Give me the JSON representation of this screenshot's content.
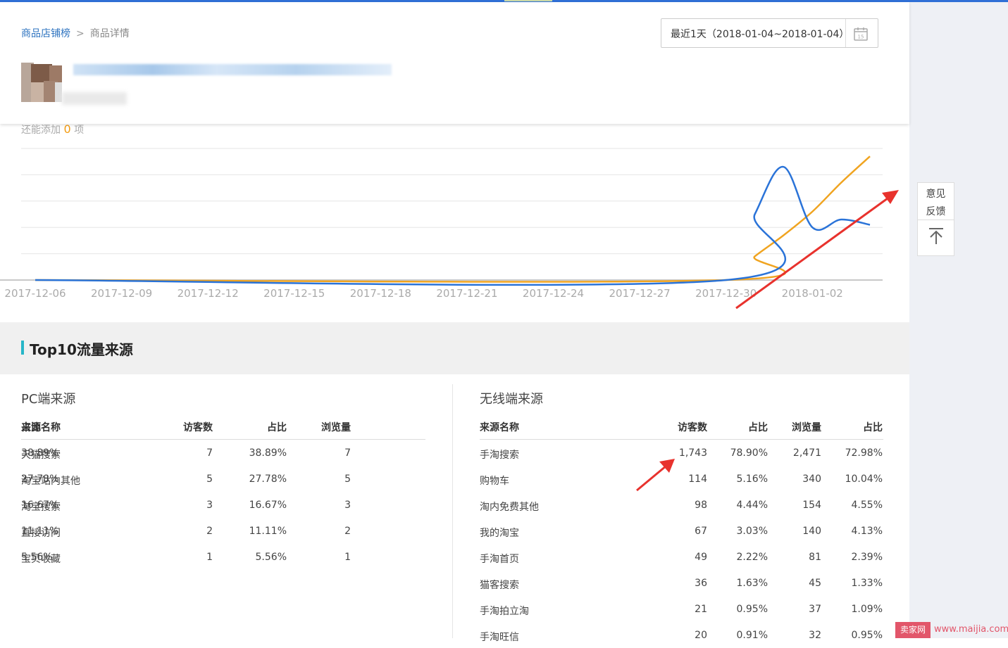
{
  "breadcrumb": {
    "root": "商品店铺榜",
    "separator": ">",
    "current": "商品详情"
  },
  "date_range": {
    "label": "最近1天（2018-01-04~2018-01-04）",
    "icon": "calendar-icon",
    "icon_text": "15"
  },
  "chart_hint": {
    "prefix": "还能添加",
    "count": "0",
    "suffix": "项"
  },
  "chart_data": {
    "type": "line",
    "x_ticks": [
      "2017-12-06",
      "2017-12-09",
      "2017-12-12",
      "2017-12-15",
      "2017-12-18",
      "2017-12-21",
      "2017-12-24",
      "2017-12-27",
      "2017-12-30",
      "2018-01-02"
    ],
    "x_start": "2017-12-06",
    "x_end": "2018-01-04",
    "ylim": [
      0,
      5
    ],
    "grid": true,
    "series": [
      {
        "color": "#2a73d8",
        "points": [
          [
            "2017-12-06",
            0
          ],
          [
            "2017-12-30",
            0
          ],
          [
            "2017-12-31",
            2.5
          ],
          [
            "2018-01-01",
            4.3
          ],
          [
            "2018-01-02",
            2.0
          ],
          [
            "2018-01-03",
            2.3
          ],
          [
            "2018-01-04",
            2.1
          ]
        ]
      },
      {
        "color": "#f0a420",
        "points": [
          [
            "2017-12-06",
            0
          ],
          [
            "2017-12-30",
            0
          ],
          [
            "2017-12-31",
            0.9
          ],
          [
            "2018-01-01",
            1.7
          ],
          [
            "2018-01-02",
            2.6
          ],
          [
            "2018-01-03",
            3.7
          ],
          [
            "2018-01-04",
            4.7
          ]
        ]
      }
    ]
  },
  "feedback": {
    "line1": "意见",
    "line2": "反馈",
    "back_top_icon": "arrow-up-to-top-icon"
  },
  "section": {
    "title": "Top10流量来源"
  },
  "pc": {
    "title": "PC端来源",
    "headers": [
      "来源名称",
      "访客数",
      "占比",
      "浏览量",
      "占比"
    ],
    "rows": [
      [
        "天猫搜索",
        "7",
        "38.89%",
        "7",
        "38.89%"
      ],
      [
        "淘宝站内其他",
        "5",
        "27.78%",
        "5",
        "27.78%"
      ],
      [
        "淘宝搜索",
        "3",
        "16.67%",
        "3",
        "16.67%"
      ],
      [
        "直接访问",
        "2",
        "11.11%",
        "2",
        "11.11%"
      ],
      [
        "宝贝收藏",
        "1",
        "5.56%",
        "1",
        "5.56%"
      ]
    ]
  },
  "mobile": {
    "title": "无线端来源",
    "headers": [
      "来源名称",
      "访客数",
      "占比",
      "浏览量",
      "占比"
    ],
    "rows": [
      [
        "手淘搜索",
        "1,743",
        "78.90%",
        "2,471",
        "72.98%"
      ],
      [
        "购物车",
        "114",
        "5.16%",
        "340",
        "10.04%"
      ],
      [
        "淘内免费其他",
        "98",
        "4.44%",
        "154",
        "4.55%"
      ],
      [
        "我的淘宝",
        "67",
        "3.03%",
        "140",
        "4.13%"
      ],
      [
        "手淘首页",
        "49",
        "2.22%",
        "81",
        "2.39%"
      ],
      [
        "猫客搜索",
        "36",
        "1.63%",
        "45",
        "1.33%"
      ],
      [
        "手淘拍立淘",
        "21",
        "0.95%",
        "37",
        "1.09%"
      ],
      [
        "手淘旺信",
        "20",
        "0.91%",
        "32",
        "0.95%"
      ]
    ]
  },
  "watermark": {
    "tag": "卖家网",
    "url": "www.maijia.com"
  },
  "colors": {
    "accent": "#2f74c0",
    "annotation_arrow": "#e8322d",
    "section_bar": "#26b6c8"
  }
}
